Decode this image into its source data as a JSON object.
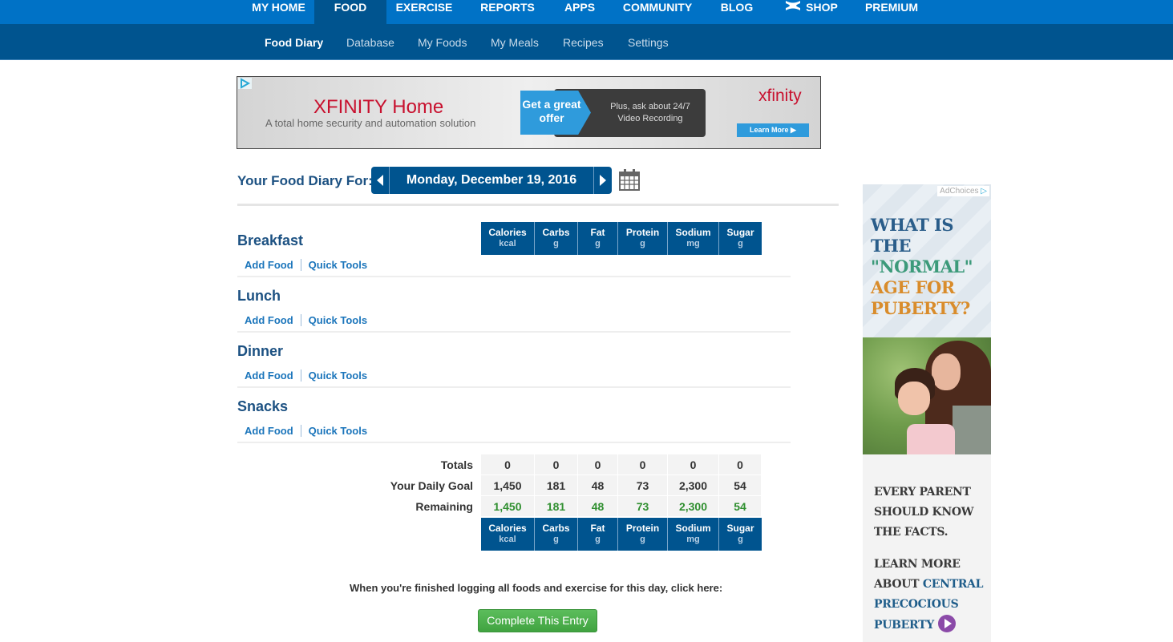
{
  "top_nav": {
    "items": [
      {
        "label": "MY HOME",
        "active": false
      },
      {
        "label": "FOOD",
        "active": true
      },
      {
        "label": "EXERCISE",
        "active": false
      },
      {
        "label": "REPORTS",
        "active": false
      },
      {
        "label": "APPS",
        "active": false
      },
      {
        "label": "COMMUNITY",
        "active": false
      },
      {
        "label": "BLOG",
        "active": false
      },
      {
        "label": "SHOP",
        "active": false,
        "icon": "under-armour-logo-icon"
      },
      {
        "label": "PREMIUM",
        "active": false
      }
    ]
  },
  "sub_nav": {
    "items": [
      {
        "label": "Food Diary",
        "active": true
      },
      {
        "label": "Database",
        "active": false
      },
      {
        "label": "My Foods",
        "active": false
      },
      {
        "label": "My Meals",
        "active": false
      },
      {
        "label": "Recipes",
        "active": false
      },
      {
        "label": "Settings",
        "active": false
      }
    ]
  },
  "top_ad": {
    "title": "XFINITY Home",
    "subtitle": "A total home security and automation solution",
    "offer": "Get a great offer",
    "offer_detail": "Plus, ask about 24/7 Video Recording",
    "brand": "xfinity",
    "cta": "Learn More ▶"
  },
  "diary": {
    "label": "Your Food Diary For:",
    "date": "Monday, December 19, 2016",
    "prev_icon": "caret-left-icon",
    "next_icon": "caret-right-icon",
    "calendar_icon": "calendar-icon"
  },
  "columns": [
    {
      "name": "Calories",
      "unit": "kcal"
    },
    {
      "name": "Carbs",
      "unit": "g"
    },
    {
      "name": "Fat",
      "unit": "g"
    },
    {
      "name": "Protein",
      "unit": "g"
    },
    {
      "name": "Sodium",
      "unit": "mg"
    },
    {
      "name": "Sugar",
      "unit": "g"
    }
  ],
  "meals": [
    {
      "name": "Breakfast",
      "add_food": "Add Food",
      "quick_tools": "Quick Tools"
    },
    {
      "name": "Lunch",
      "add_food": "Add Food",
      "quick_tools": "Quick Tools"
    },
    {
      "name": "Dinner",
      "add_food": "Add Food",
      "quick_tools": "Quick Tools"
    },
    {
      "name": "Snacks",
      "add_food": "Add Food",
      "quick_tools": "Quick Tools"
    }
  ],
  "summary": {
    "totals": {
      "label": "Totals",
      "values": [
        "0",
        "0",
        "0",
        "0",
        "0",
        "0"
      ]
    },
    "goal": {
      "label": "Your Daily Goal",
      "values": [
        "1,450",
        "181",
        "48",
        "73",
        "2,300",
        "54"
      ]
    },
    "remaining": {
      "label": "Remaining",
      "values": [
        "1,450",
        "181",
        "48",
        "73",
        "2,300",
        "54"
      ]
    }
  },
  "finish": {
    "text": "When you're finished logging all foods and exercise for this day, click here:",
    "button": "Complete This Entry"
  },
  "side_ad": {
    "adchoices": "AdChoices",
    "headline_1": "WHAT IS THE",
    "headline_2": "\"NORMAL\"",
    "headline_3": "AGE FOR PUBERTY?",
    "body_1": "EVERY PARENT SHOULD KNOW THE FACTS.",
    "body_2a": "LEARN MORE ABOUT",
    "body_2b": "CENTRAL PRECOCIOUS PUBERTY"
  },
  "colors": {
    "nav_primary": "#0072c6",
    "nav_secondary": "#00548f",
    "heading_blue": "#1c5182",
    "link_blue": "#1b75bb",
    "remaining_green": "#2f8f2f",
    "button_green": "#4cae4c"
  }
}
